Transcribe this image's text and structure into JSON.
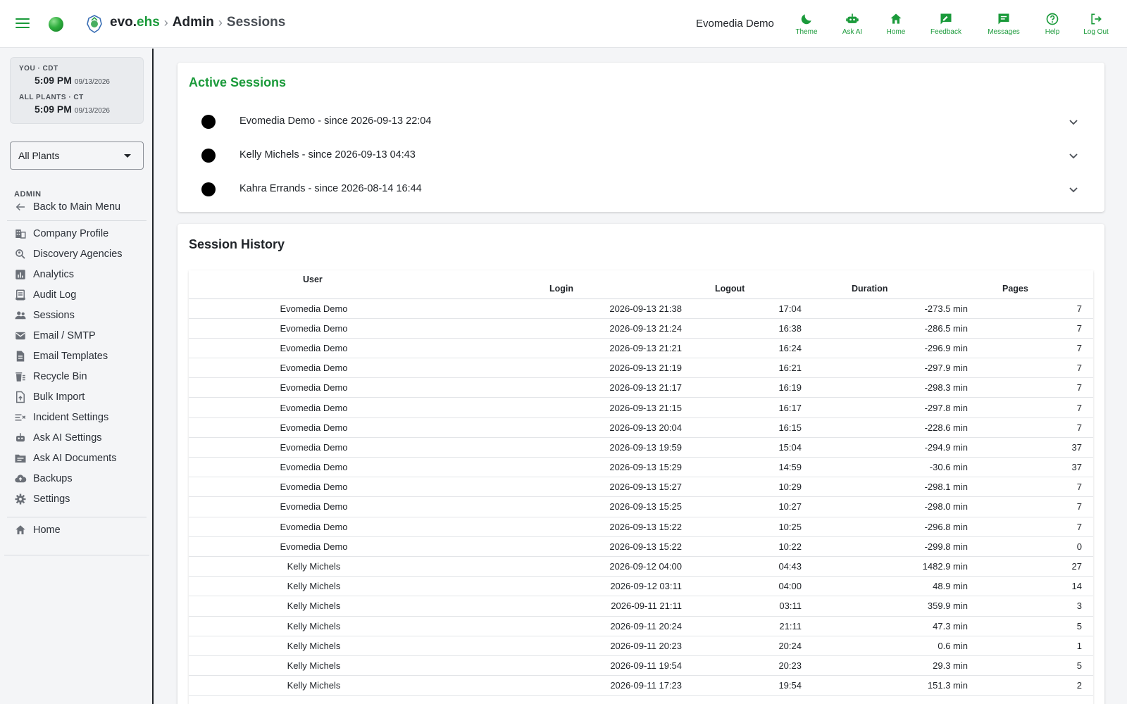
{
  "header": {
    "brand_prefix": "evo.",
    "brand_suffix": "ehs",
    "breadcrumb_sep": "›",
    "breadcrumb_admin": "Admin",
    "breadcrumb_current": "Sessions",
    "user_name": "Evomedia Demo",
    "buttons": [
      {
        "label": "Theme",
        "icon": "moon-icon"
      },
      {
        "label": "Ask AI",
        "icon": "robot-icon"
      },
      {
        "label": "Home",
        "icon": "home-icon"
      },
      {
        "label": "Feedback",
        "icon": "feedback-icon"
      },
      {
        "label": "Messages",
        "icon": "message-icon"
      },
      {
        "label": "Help",
        "icon": "help-icon"
      },
      {
        "label": "Log Out",
        "icon": "logout-icon"
      }
    ]
  },
  "clock": {
    "you_label": "YOU · CDT",
    "you_time": "5:09 PM",
    "you_date": "09/13/2026",
    "plants_label": "ALL PLANTS · CT",
    "plants_time": "5:09 PM",
    "plants_date": "09/13/2026"
  },
  "plant_select": {
    "value": "All Plants"
  },
  "sidebar": {
    "section_label": "ADMIN",
    "back_label": "Back to Main Menu",
    "items": [
      {
        "label": "Company Profile",
        "icon": "building-icon"
      },
      {
        "label": "Discovery Agencies",
        "icon": "agency-search-icon"
      },
      {
        "label": "Analytics",
        "icon": "analytics-icon"
      },
      {
        "label": "Audit Log",
        "icon": "audit-log-icon"
      },
      {
        "label": "Sessions",
        "icon": "people-icon"
      },
      {
        "label": "Email / SMTP",
        "icon": "email-icon"
      },
      {
        "label": "Email Templates",
        "icon": "document-icon"
      },
      {
        "label": "Recycle Bin",
        "icon": "recycle-bin-icon"
      },
      {
        "label": "Bulk Import",
        "icon": "upload-icon"
      },
      {
        "label": "Incident Settings",
        "icon": "incident-settings-icon"
      },
      {
        "label": "Ask AI Settings",
        "icon": "robot-icon"
      },
      {
        "label": "Ask AI Documents",
        "icon": "folder-icon"
      },
      {
        "label": "Backups",
        "icon": "cloud-icon"
      },
      {
        "label": "Settings",
        "icon": "gear-icon"
      }
    ],
    "home_label": "Home"
  },
  "active_sessions": {
    "title": "Active Sessions",
    "items": [
      "Evomedia Demo - since 2026-09-13 22:04",
      "Kelly Michels - since 2026-09-13 04:43",
      "Kahra Errands - since 2026-08-14 16:44"
    ]
  },
  "history": {
    "title": "Session History",
    "columns": [
      "User",
      "Login",
      "Logout",
      "Duration",
      "Pages"
    ],
    "rows": [
      [
        "Evomedia Demo",
        "2026-09-13 21:38",
        "17:04",
        "-273.5 min",
        "7"
      ],
      [
        "Evomedia Demo",
        "2026-09-13 21:24",
        "16:38",
        "-286.5 min",
        "7"
      ],
      [
        "Evomedia Demo",
        "2026-09-13 21:21",
        "16:24",
        "-296.9 min",
        "7"
      ],
      [
        "Evomedia Demo",
        "2026-09-13 21:19",
        "16:21",
        "-297.9 min",
        "7"
      ],
      [
        "Evomedia Demo",
        "2026-09-13 21:17",
        "16:19",
        "-298.3 min",
        "7"
      ],
      [
        "Evomedia Demo",
        "2026-09-13 21:15",
        "16:17",
        "-297.8 min",
        "7"
      ],
      [
        "Evomedia Demo",
        "2026-09-13 20:04",
        "16:15",
        "-228.6 min",
        "7"
      ],
      [
        "Evomedia Demo",
        "2026-09-13 19:59",
        "15:04",
        "-294.9 min",
        "37"
      ],
      [
        "Evomedia Demo",
        "2026-09-13 15:29",
        "14:59",
        "-30.6 min",
        "37"
      ],
      [
        "Evomedia Demo",
        "2026-09-13 15:27",
        "10:29",
        "-298.1 min",
        "7"
      ],
      [
        "Evomedia Demo",
        "2026-09-13 15:25",
        "10:27",
        "-298.0 min",
        "7"
      ],
      [
        "Evomedia Demo",
        "2026-09-13 15:22",
        "10:25",
        "-296.8 min",
        "7"
      ],
      [
        "Evomedia Demo",
        "2026-09-13 15:22",
        "10:22",
        "-299.8 min",
        "0"
      ],
      [
        "Kelly Michels",
        "2026-09-12 04:00",
        "04:43",
        "1482.9 min",
        "27"
      ],
      [
        "Kelly Michels",
        "2026-09-12 03:11",
        "04:00",
        "48.9 min",
        "14"
      ],
      [
        "Kelly Michels",
        "2026-09-11 21:11",
        "03:11",
        "359.9 min",
        "3"
      ],
      [
        "Kelly Michels",
        "2026-09-11 20:24",
        "21:11",
        "47.3 min",
        "5"
      ],
      [
        "Kelly Michels",
        "2026-09-11 20:23",
        "20:24",
        "0.6 min",
        "1"
      ],
      [
        "Kelly Michels",
        "2026-09-11 19:54",
        "20:23",
        "29.3 min",
        "5"
      ],
      [
        "Kelly Michels",
        "2026-09-11 17:23",
        "19:54",
        "151.3 min",
        "2"
      ]
    ]
  },
  "colors": {
    "accent": "#1a9a3a",
    "text": "#1f2328",
    "sidebar_bg": "#f4f5f7"
  }
}
